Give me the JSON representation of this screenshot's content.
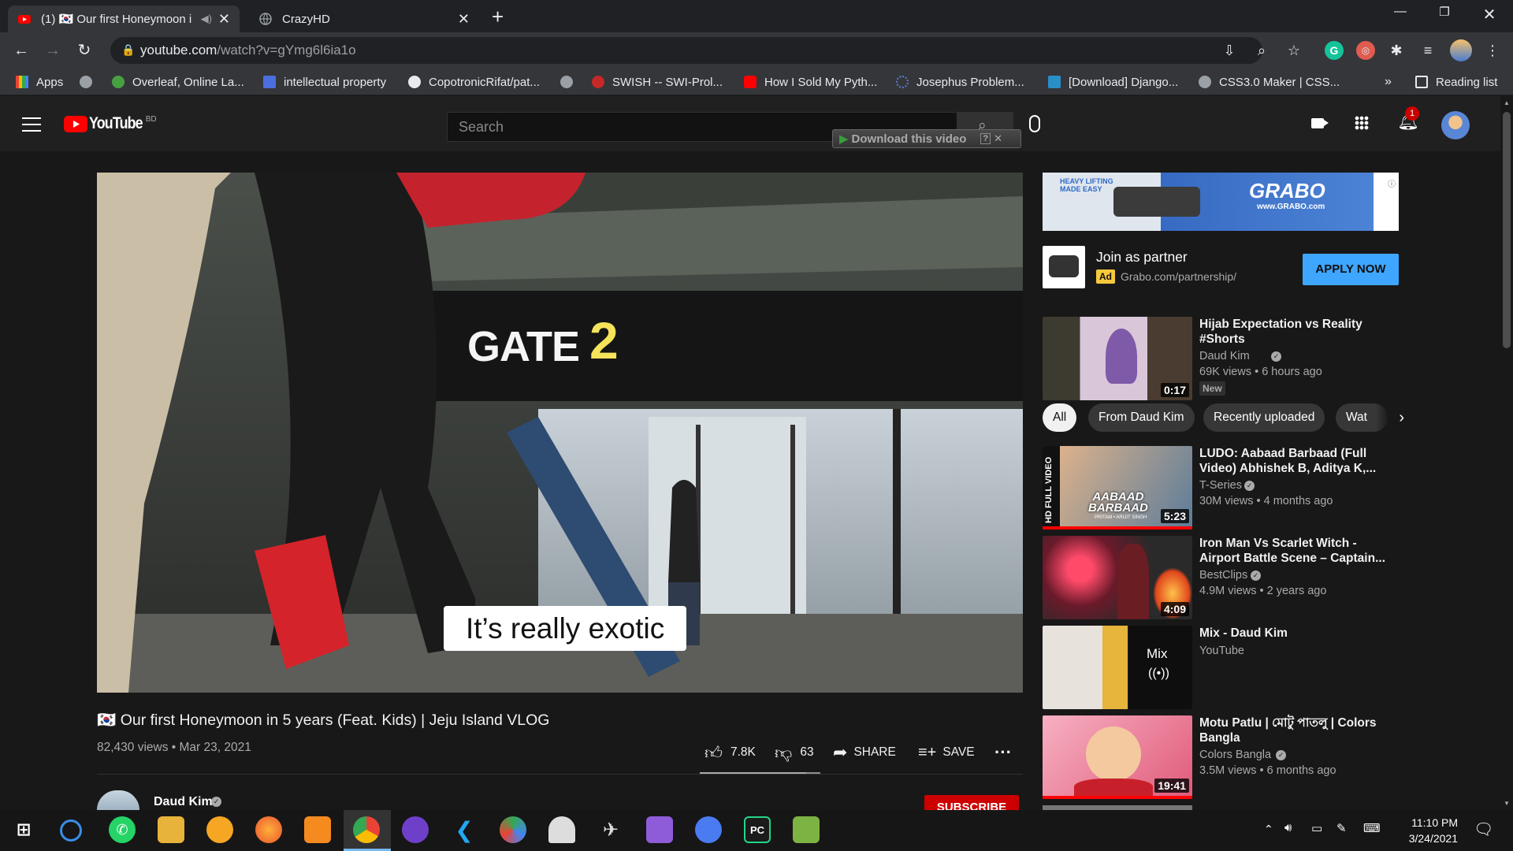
{
  "browser": {
    "tabs": [
      {
        "title": "(1) 🇰🇷 Our first Honeymoon i",
        "active": true
      },
      {
        "title": "CrazyHD",
        "active": false
      }
    ],
    "new_tab_symbol": "+",
    "url_host": "youtube.com",
    "url_path": "/watch?v=gYmg6l6ia1o",
    "bookmarks": [
      "Apps",
      "Overleaf, Online La...",
      "intellectual property",
      "CopotronicRifat/pat...",
      "SWISH -- SWI-Prol...",
      "How I Sold My Pyth...",
      "Josephus Problem...",
      "[Download] Django...",
      "CSS3.0 Maker | CSS...",
      "Reading list"
    ],
    "bookmarks_overflow": "»"
  },
  "youtube": {
    "logo_text": "YouTube",
    "country": "BD",
    "search_placeholder": "Search",
    "download_overlay": "Download this video",
    "notification_count": "1"
  },
  "video": {
    "caption": "It’s really exotic",
    "sign_text": "GATE",
    "sign_number": "2",
    "title": "🇰🇷 Our first Honeymoon in 5 years (Feat. Kids) | Jeju Island VLOG",
    "views_date": "82,430 views • Mar 23, 2021",
    "likes": "7.8K",
    "dislikes": "63",
    "share_label": "SHARE",
    "save_label": "SAVE",
    "channel": "Daud Kim",
    "subscribe_label": "SUBSCRIBE"
  },
  "ad": {
    "banner_brand": "GRABO",
    "banner_site": "www.GRABO.com",
    "banner_tagline": "HEAVY LIFTING MADE EASY",
    "title": "Join as partner",
    "badge": "Ad",
    "url": "Grabo.com/partnership/",
    "cta": "APPLY NOW"
  },
  "chips": [
    "All",
    "From Daud Kim",
    "Recently uploaded",
    "Wat"
  ],
  "recommendations": [
    {
      "title": "Hijab Expectation vs Reality #Shorts",
      "channel": "Daud Kim",
      "verified": true,
      "meta": "69K views • 6 hours ago",
      "badge": "New",
      "duration": "0:17"
    },
    {
      "title": "LUDO: Aabaad Barbaad (Full Video) Abhishek B, Aditya K,...",
      "channel": "T-Series",
      "verified": true,
      "meta": "30M views • 4 months ago",
      "duration": "5:23"
    },
    {
      "title": "Iron Man Vs Scarlet Witch - Airport Battle Scene – Captain...",
      "channel": "BestClips",
      "verified": true,
      "meta": "4.9M views • 2 years ago",
      "duration": "4:09"
    },
    {
      "title": "Mix - Daud Kim",
      "channel": "YouTube",
      "verified": false,
      "meta": "",
      "mix_label": "Mix"
    },
    {
      "title": "Motu Patlu | মোটু পাতলু | Colors Bangla",
      "channel": "Colors Bangla",
      "verified": true,
      "meta": "3.5M views • 6 months ago",
      "duration": "19:41"
    }
  ],
  "thumb_text": {
    "ludo_side": "HD FULL VIDEO",
    "ludo_line1": "AABAAD",
    "ludo_line2": "BARBAAD",
    "ludo_small": "PRITAM • ARIJIT SINGH"
  },
  "taskbar": {
    "time": "11:10 PM",
    "date": "3/24/2021"
  },
  "colors": {
    "youtube_red": "#ff0000",
    "cta_blue": "#3ea6ff",
    "ad_badge": "#f8c83c"
  }
}
